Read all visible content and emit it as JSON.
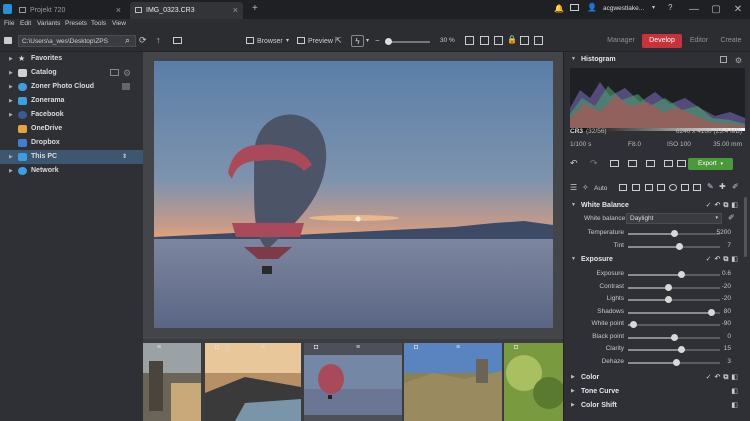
{
  "titlebar": {
    "tabs": [
      {
        "label": "Projekt 720",
        "active": false
      },
      {
        "label": "IMG_0323.CR3",
        "active": true
      }
    ],
    "new_tab": "+",
    "user": "acgwestlake...",
    "icons": [
      "bell-icon",
      "mail-icon",
      "user-icon",
      "chevron-down-icon",
      "help-icon"
    ],
    "window_controls": [
      "—",
      "▢",
      "✕"
    ]
  },
  "menu": [
    "File",
    "Edit",
    "Variants",
    "Presets",
    "Tools",
    "View"
  ],
  "toolbar": {
    "path": "C:\\Users\\a_wes\\Desktop\\ZPS",
    "browser_label": "Browser",
    "preview_label": "Preview",
    "zoom": "30 %",
    "modes": [
      "Manager",
      "Develop",
      "Editor",
      "Create"
    ],
    "active_mode": "Develop"
  },
  "sidebar": {
    "items": [
      {
        "label": "Favorites",
        "icon": "star-icon",
        "color": "#d9d9d9"
      },
      {
        "label": "Catalog",
        "icon": "catalog-icon",
        "color": "#d9d9d9"
      },
      {
        "label": "Zoner Photo Cloud",
        "icon": "cloud-icon",
        "color": "#3aa0e0"
      },
      {
        "label": "Zonerama",
        "icon": "zonerama-icon",
        "color": "#3aa0e0"
      },
      {
        "label": "Facebook",
        "icon": "facebook-icon",
        "color": "#3b5998"
      },
      {
        "label": "OneDrive",
        "icon": "onedrive-icon",
        "color": "#e8a33a"
      },
      {
        "label": "Dropbox",
        "icon": "dropbox-icon",
        "color": "#3d7fd0"
      },
      {
        "label": "This PC",
        "icon": "pc-icon",
        "color": "#3aa0e0"
      },
      {
        "label": "Network",
        "icon": "network-icon",
        "color": "#3aa0e0"
      }
    ],
    "selected": "This PC"
  },
  "histogram": {
    "title": "Histogram",
    "format": "CR3",
    "index": "(32/56)",
    "dimensions": "6240 x 4160 (23.4 MB)",
    "shutter": "1/100 s",
    "aperture": "F8.0",
    "iso": "ISO 100",
    "focal": "35.00 mm"
  },
  "develop": {
    "auto_label": "Auto",
    "export_label": "Export",
    "white_balance": {
      "title": "White Balance",
      "wb_label": "White balance",
      "wb_value": "Daylight",
      "sliders": [
        {
          "label": "Temperature",
          "value": "5200",
          "pos": 0.5
        },
        {
          "label": "Tint",
          "value": "7",
          "pos": 0.55
        }
      ]
    },
    "exposure": {
      "title": "Exposure",
      "sliders": [
        {
          "label": "Exposure",
          "value": "0.6",
          "pos": 0.58
        },
        {
          "label": "Contrast",
          "value": "-20",
          "pos": 0.44
        },
        {
          "label": "Lights",
          "value": "-20",
          "pos": 0.44
        },
        {
          "label": "Shadows",
          "value": "80",
          "pos": 0.9
        },
        {
          "label": "White point",
          "value": "-90",
          "pos": 0.05
        },
        {
          "label": "Black point",
          "value": "0",
          "pos": 0.5
        },
        {
          "label": "Clarity",
          "value": "15",
          "pos": 0.58
        },
        {
          "label": "Dehaze",
          "value": "3",
          "pos": 0.52
        }
      ]
    },
    "collapsed_sections": [
      "Color",
      "Tone Curve",
      "Color Shift"
    ]
  },
  "filmstrip": {
    "thumbs": [
      {
        "name": "tower-thumb"
      },
      {
        "name": "castle-sunset-thumb"
      },
      {
        "name": "balloon-thumb"
      },
      {
        "name": "ruins-thumb"
      },
      {
        "name": "trees-thumb"
      }
    ],
    "selected_index": 2
  },
  "colors": {
    "accent_red": "#c8323a",
    "export_green": "#4a9a3a",
    "selection_blue": "#3f5670"
  }
}
